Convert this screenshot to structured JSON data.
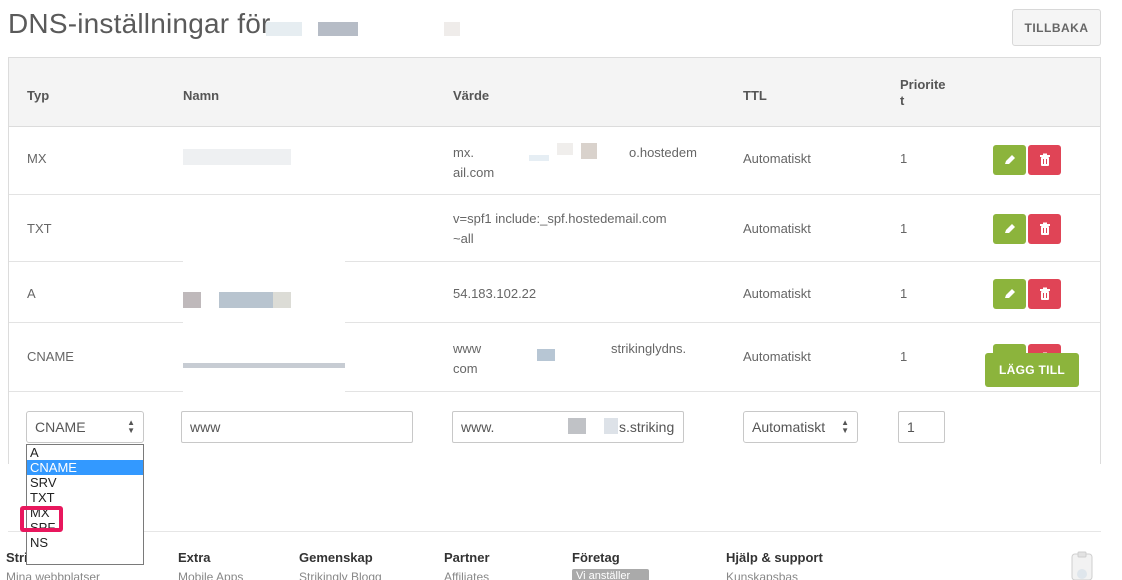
{
  "header": {
    "title": "DNS-inställningar för",
    "back_label": "TILLBAKA"
  },
  "table": {
    "columns": [
      "Typ",
      "Namn",
      "Värde",
      "TTL",
      "Priorite\nt"
    ],
    "rows": [
      {
        "type": "MX",
        "value_line1": "mx.",
        "value_suffix": "o.hostedem",
        "value_line2": "ail.com",
        "ttl": "Automatiskt",
        "priority": "1"
      },
      {
        "type": "TXT",
        "value_line1": "v=spf1 include:_spf.hostedemail.com",
        "value_line2": "~all",
        "ttl": "Automatiskt",
        "priority": "1"
      },
      {
        "type": "A",
        "value_line1": "54.183.102.22",
        "ttl": "Automatiskt",
        "priority": "1"
      },
      {
        "type": "CNAME",
        "value_line1": "www",
        "value_suffix": "strikinglydns.",
        "value_line2": "com",
        "ttl": "Automatiskt",
        "priority": "1"
      }
    ]
  },
  "add_form": {
    "type_select": "CNAME",
    "name_input": "www",
    "value_prefix": "www.",
    "value_suffix": "s.striking",
    "ttl_select": "Automatiskt",
    "priority_input": "1",
    "add_label": "LÄGG TILL"
  },
  "type_dropdown": {
    "options": [
      "A",
      "CNAME",
      "SRV",
      "TXT",
      "MX",
      "SPF",
      "NS"
    ],
    "selected": "CNAME"
  },
  "footer": {
    "columns": [
      "Stri",
      "Extra",
      "Gemenskap",
      "Partner",
      "Företag",
      "Hjälp & support"
    ],
    "links": [
      "Mina webbplatser",
      "Mobile Apps",
      "Strikingly Blogg",
      "Affiliates",
      "Vi anställer",
      "Kunskapsbas"
    ]
  },
  "colors": {
    "edit": "#8cb43c",
    "delete": "#e04456",
    "highlight": "#e8175d",
    "selected_option": "#3399ff"
  }
}
